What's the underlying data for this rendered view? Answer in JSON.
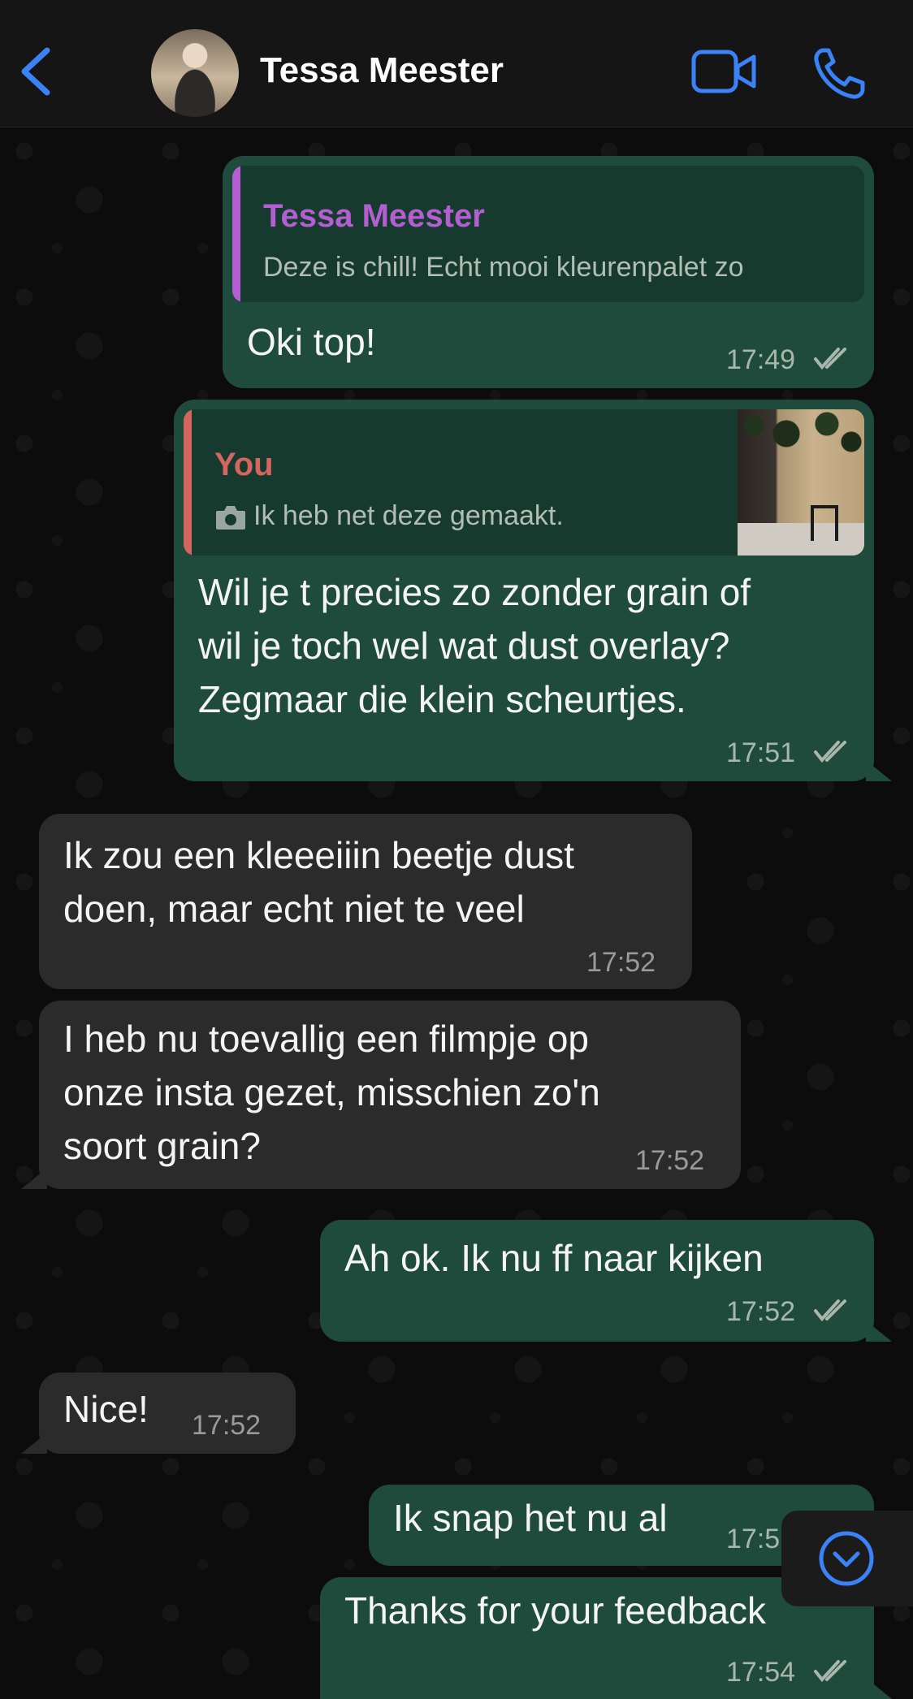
{
  "header": {
    "contact_name": "Tessa Meester",
    "icons": [
      "chevron-left-icon",
      "video-camera-icon",
      "phone-icon"
    ]
  },
  "colors": {
    "accent": "#3b82f6",
    "outgoing_bubble": "#1f4b3c",
    "incoming_bubble": "#2b2b2c",
    "quote_author_tessa": "#b35ed1",
    "quote_author_you": "#d4665f"
  },
  "messages": [
    {
      "direction": "outgoing",
      "reply_to": {
        "author": "Tessa Meester",
        "text": "Deze is chill! Echt mooi kleurenpalet zo"
      },
      "text": "Oki top!",
      "time": "17:49",
      "status": "read"
    },
    {
      "direction": "outgoing",
      "reply_to": {
        "author": "You",
        "text": "Ik heb net deze gemaakt.",
        "has_photo": true
      },
      "text": "Wil je t precies zo zonder grain of\nwil je toch wel wat dust overlay?\nZegmaar die klein scheurtjes.",
      "time": "17:51",
      "status": "read"
    },
    {
      "direction": "incoming",
      "text": "Ik zou een kleeeiiin beetje dust\ndoen, maar echt niet te veel",
      "time": "17:52"
    },
    {
      "direction": "incoming",
      "text": "I heb nu toevallig een filmpje op\nonze insta gezet, misschien zo'n\nsoort grain?",
      "time": "17:52"
    },
    {
      "direction": "outgoing",
      "text": "Ah ok. Ik nu ff naar kijken",
      "time": "17:52",
      "status": "read"
    },
    {
      "direction": "incoming",
      "text": "Nice!",
      "time": "17:52"
    },
    {
      "direction": "outgoing",
      "text": "Ik snap het nu al",
      "time": "17:5",
      "status": "read"
    },
    {
      "direction": "outgoing",
      "text": "Thanks for your feedback",
      "time": "17:54",
      "status": "read"
    }
  ]
}
